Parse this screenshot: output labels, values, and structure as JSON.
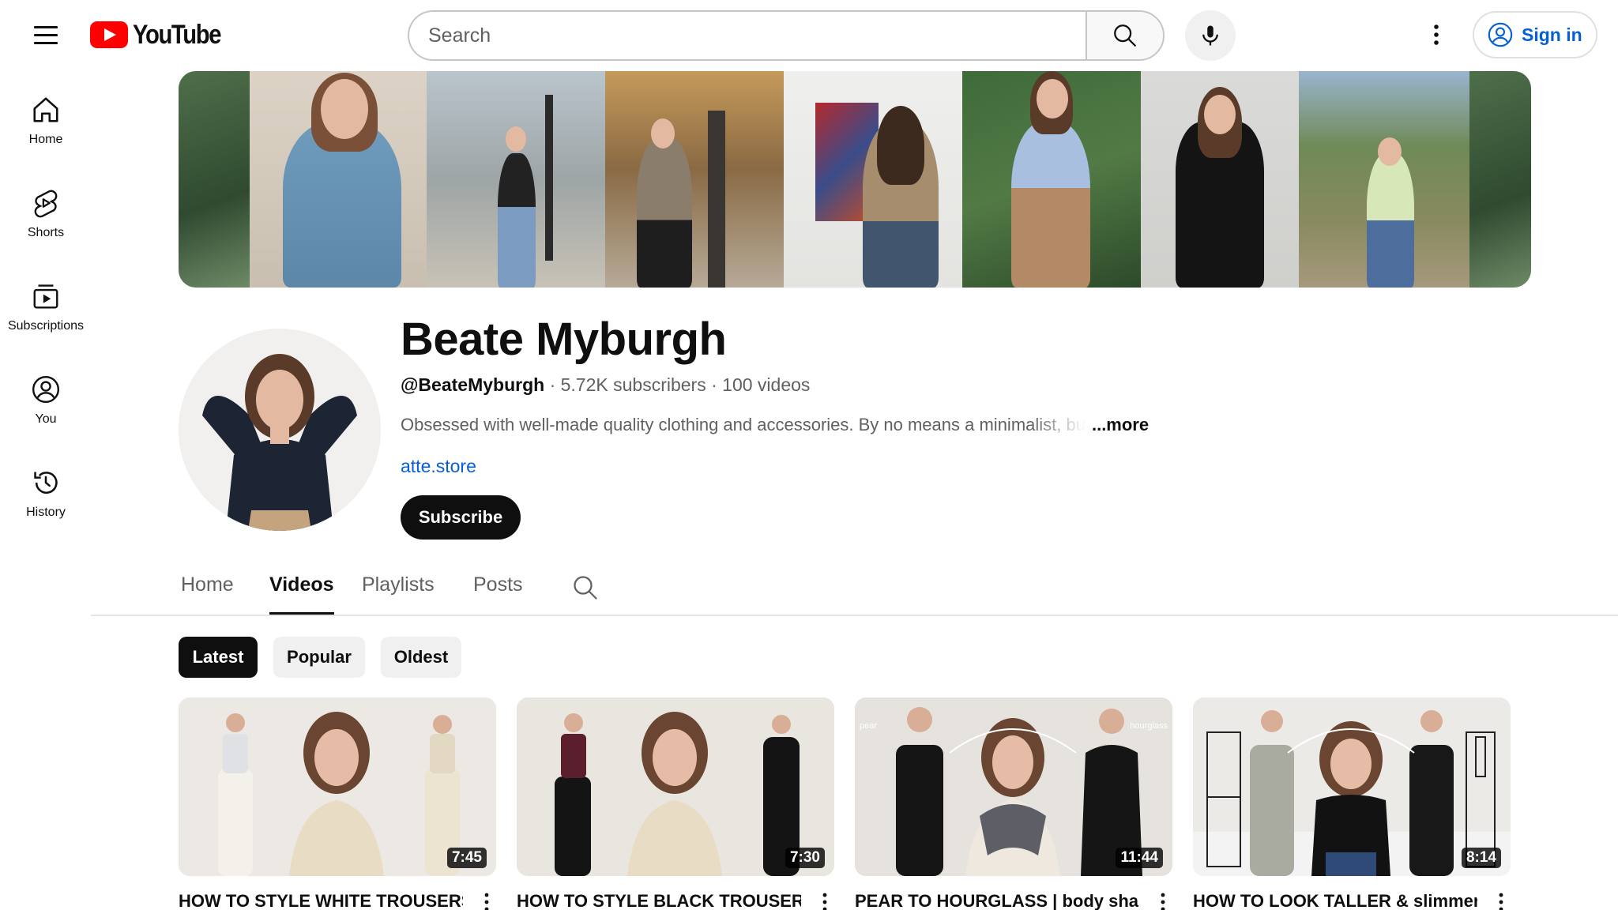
{
  "header": {
    "logo_text": "YouTube",
    "search_placeholder": "Search",
    "sign_in_label": "Sign in"
  },
  "sidebar": {
    "items": [
      {
        "label": "Home",
        "icon": "home-icon"
      },
      {
        "label": "Shorts",
        "icon": "shorts-icon"
      },
      {
        "label": "Subscriptions",
        "icon": "subscriptions-icon"
      },
      {
        "label": "You",
        "icon": "you-icon"
      },
      {
        "label": "History",
        "icon": "history-icon"
      }
    ]
  },
  "channel": {
    "name": "Beate Myburgh",
    "handle": "@BeateMyburgh",
    "subscribers": "5.72K subscribers",
    "videos_count": "100 videos",
    "separator": "·",
    "description": "Obsessed with well-made quality clothing and accessories. By no means a minimalist, bu",
    "more_label": "...more",
    "link": "atte.store",
    "subscribe_label": "Subscribe"
  },
  "tabs": [
    {
      "label": "Home",
      "active": false
    },
    {
      "label": "Videos",
      "active": true
    },
    {
      "label": "Playlists",
      "active": false
    },
    {
      "label": "Posts",
      "active": false
    }
  ],
  "chips": [
    {
      "label": "Latest",
      "active": true
    },
    {
      "label": "Popular",
      "active": false
    },
    {
      "label": "Oldest",
      "active": false
    }
  ],
  "videos": [
    {
      "title": "HOW TO STYLE WHITE TROUSERS |",
      "duration": "7:45"
    },
    {
      "title": "HOW TO STYLE BLACK TROUSERS |",
      "duration": "7:30"
    },
    {
      "title": "PEAR TO HOURGLASS | body shape,",
      "duration": "11:44",
      "overlay_left": "pear",
      "overlay_right": "hourglass"
    },
    {
      "title": "HOW TO LOOK TALLER & slimmer",
      "duration": "8:14"
    }
  ],
  "colors": {
    "brand_red": "#ff0000",
    "link_blue": "#065fd4",
    "text_primary": "#0f0f0f",
    "text_secondary": "#606060",
    "chip_bg": "#f0f0f0"
  }
}
